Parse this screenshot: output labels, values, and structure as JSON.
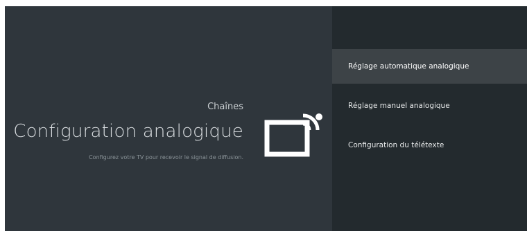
{
  "header": {
    "category": "Chaînes",
    "title": "Configuration analogique",
    "description": "Configurez votre TV pour recevoir le signal de diffusion."
  },
  "icon": {
    "name": "tv-signal-icon",
    "color": "#ffffff"
  },
  "menu": {
    "selected_index": 0,
    "items": [
      {
        "label": "Réglage automatique analogique"
      },
      {
        "label": "Réglage manuel analogique"
      },
      {
        "label": "Configuration du télétexte"
      }
    ]
  },
  "colors": {
    "left_background": "#2f363c",
    "right_background": "#232a2e",
    "selected_background": "#3d4347"
  }
}
